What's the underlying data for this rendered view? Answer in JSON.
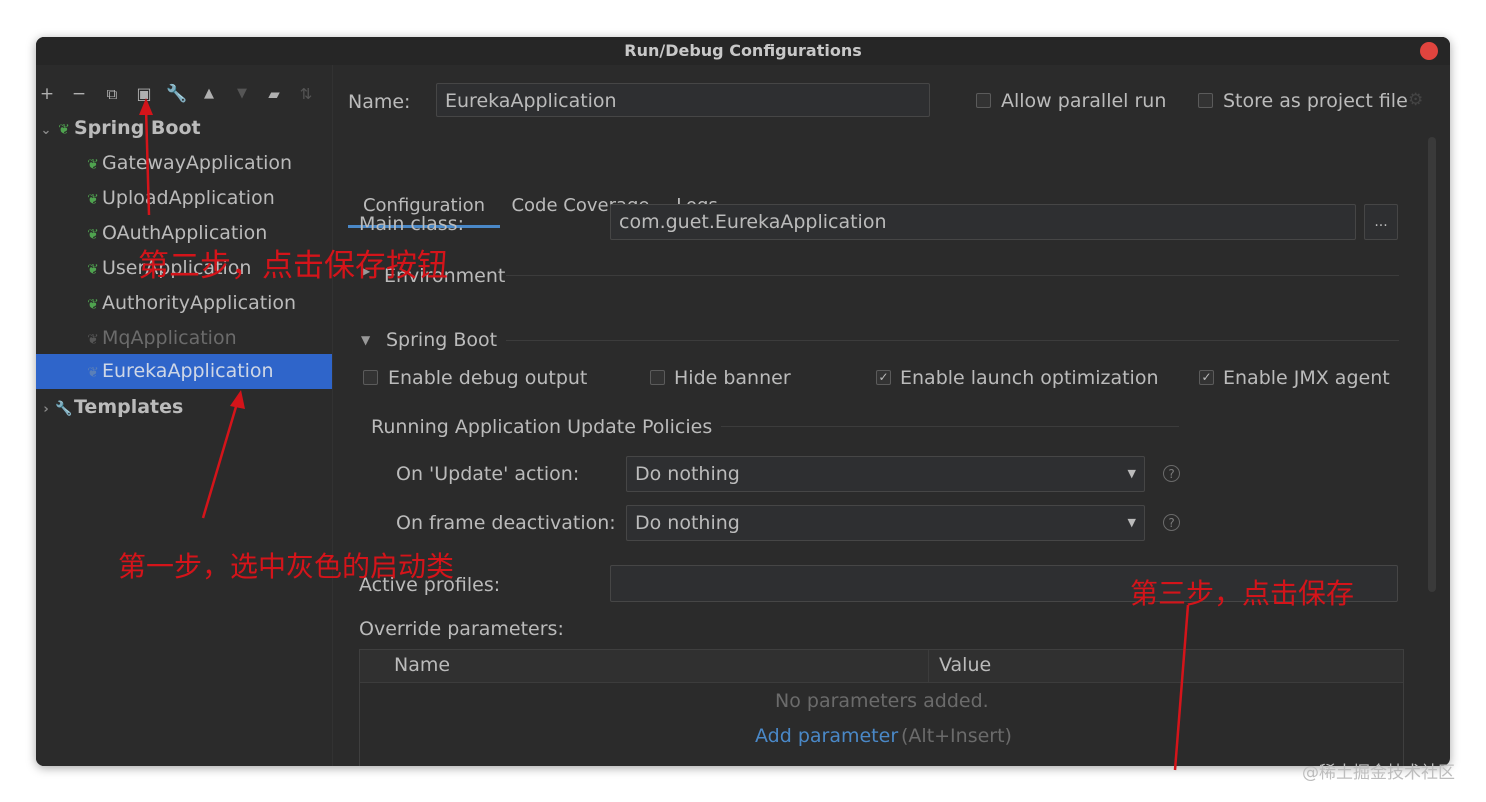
{
  "window": {
    "title": "Run/Debug Configurations"
  },
  "toolbar": {
    "add_icon": "plus-icon",
    "remove_icon": "minus-icon",
    "copy_icon": "copy-icon",
    "save_icon": "save-icon",
    "edit_icon": "wrench-icon",
    "up_icon": "arrow-up-icon",
    "down_icon": "arrow-down-icon",
    "folder_icon": "folder-icon",
    "sort_icon": "sort-icon"
  },
  "tree": {
    "groups": [
      {
        "label": "Spring Boot",
        "expanded": true,
        "items": [
          {
            "label": "GatewayApplication",
            "state": "normal"
          },
          {
            "label": "UploadApplication",
            "state": "normal"
          },
          {
            "label": "OAuthApplication",
            "state": "normal"
          },
          {
            "label": "UserApplication",
            "state": "normal"
          },
          {
            "label": "AuthorityApplication",
            "state": "normal"
          },
          {
            "label": "MqApplication",
            "state": "disabled"
          },
          {
            "label": "EurekaApplication",
            "state": "selected"
          }
        ]
      },
      {
        "label": "Templates",
        "expanded": false
      }
    ]
  },
  "header": {
    "name_label": "Name:",
    "name_value": "EurekaApplication",
    "allow_parallel_label": "Allow parallel run",
    "allow_parallel_checked": false,
    "store_project_label": "Store as project file",
    "store_project_checked": false
  },
  "tabs": [
    {
      "label": "Configuration",
      "active": true
    },
    {
      "label": "Code Coverage",
      "active": false
    },
    {
      "label": "Logs",
      "active": false
    }
  ],
  "config": {
    "main_class_label": "Main class:",
    "main_class_value": "com.guet.EurekaApplication",
    "browse_label": "...",
    "environment_label": "Environment",
    "spring_boot_label": "Spring Boot",
    "enable_debug_label": "Enable debug output",
    "enable_debug_checked": false,
    "hide_banner_label": "Hide banner",
    "hide_banner_checked": false,
    "launch_opt_label": "Enable launch optimization",
    "launch_opt_checked": true,
    "jmx_label": "Enable JMX agent",
    "jmx_checked": true,
    "update_policies_label": "Running Application Update Policies",
    "on_update_label": "On 'Update' action:",
    "on_update_value": "Do nothing",
    "on_frame_label": "On frame deactivation:",
    "on_frame_value": "Do nothing",
    "help_glyph": "?",
    "active_profiles_label": "Active profiles:",
    "active_profiles_value": "",
    "override_label": "Override parameters:",
    "table": {
      "col_name": "Name",
      "col_value": "Value",
      "empty_text": "No parameters added.",
      "add_link": "Add parameter",
      "add_shortcut": "(Alt+Insert)"
    }
  },
  "annotations": {
    "step1": "第一步，选中灰色的启动类",
    "step2": "第二步，点击保存按钮",
    "step3": "第三步，点击保存"
  },
  "watermark": "@稀土掘金技术社区",
  "colors": {
    "background": "#2b2b2b",
    "selection": "#2f65ca",
    "annotation": "#d4141a",
    "link": "#4a88c7",
    "spring_icon": "#4fa34f"
  }
}
